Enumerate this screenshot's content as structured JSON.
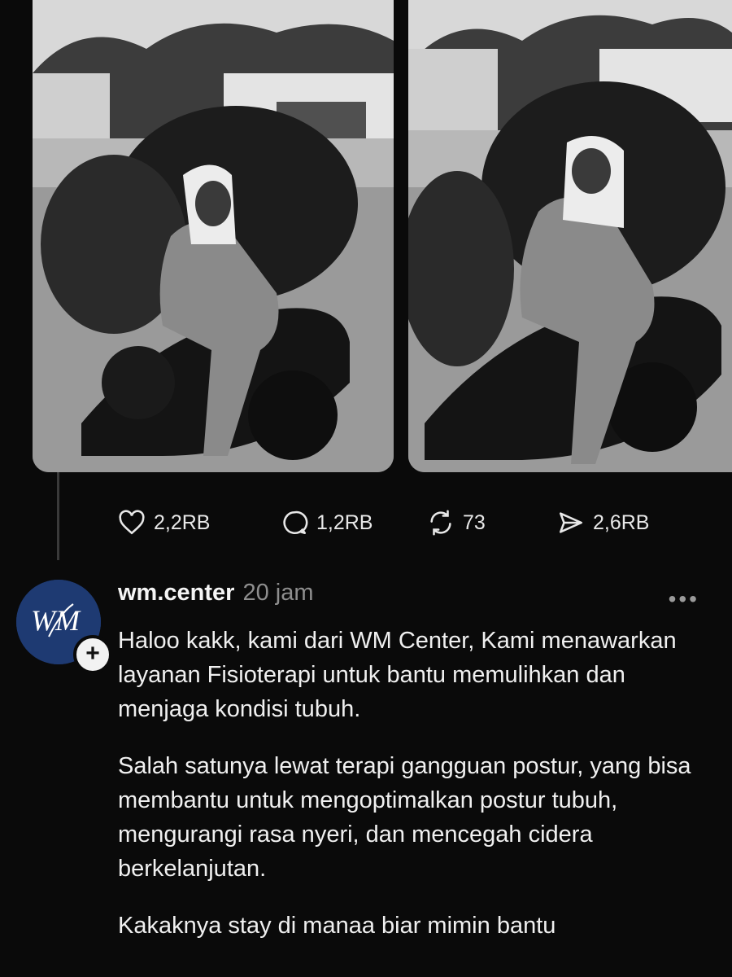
{
  "post": {
    "photos": [
      {
        "icon": "photo-girl-on-motorbike"
      },
      {
        "icon": "photo-girl-on-motorbike-2"
      }
    ],
    "actions": {
      "likes": "2,2RB",
      "comments": "1,2RB",
      "reposts": "73",
      "shares": "2,6RB"
    }
  },
  "reply": {
    "avatar_text": "WM",
    "username": "wm.center",
    "time": "20 jam",
    "more": "•••",
    "paragraphs": [
      "Haloo kakk, kami dari WM Center, Kami menawarkan layanan Fisioterapi untuk bantu memulihkan dan menjaga kondisi tubuh.",
      "Salah satunya lewat terapi gangguan postur, yang bisa membantu untuk mengoptimalkan postur tubuh, mengurangi rasa nyeri, dan mencegah cidera berkelanjutan.",
      "Kakaknya stay di manaa biar mimin bantu"
    ]
  },
  "colors": {
    "background": "#0a0a0a",
    "avatar": "#1e3a72",
    "muted": "#8e8e8e"
  }
}
